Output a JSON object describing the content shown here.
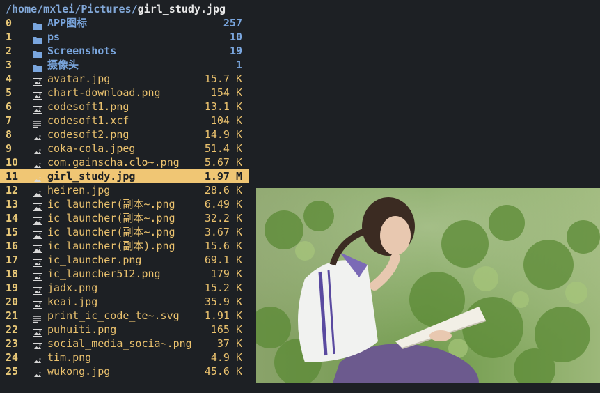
{
  "path": {
    "dir": "/home/mxlei/Pictures/",
    "file": "girl_study.jpg"
  },
  "entries": [
    {
      "num": "0",
      "name": "APP图标",
      "size": "257",
      "kind": "folder"
    },
    {
      "num": "1",
      "name": "ps",
      "size": "10",
      "kind": "folder"
    },
    {
      "num": "2",
      "name": "Screenshots",
      "size": "19",
      "kind": "folder"
    },
    {
      "num": "3",
      "name": "摄像头",
      "size": "1",
      "kind": "folder"
    },
    {
      "num": "4",
      "name": "avatar.jpg",
      "size": "15.7 K",
      "kind": "image"
    },
    {
      "num": "5",
      "name": "chart-download.png",
      "size": "154 K",
      "kind": "image"
    },
    {
      "num": "6",
      "name": "codesoft1.png",
      "size": "13.1 K",
      "kind": "image"
    },
    {
      "num": "7",
      "name": "codesoft1.xcf",
      "size": "104 K",
      "kind": "text"
    },
    {
      "num": "8",
      "name": "codesoft2.png",
      "size": "14.9 K",
      "kind": "image"
    },
    {
      "num": "9",
      "name": "coka-cola.jpeg",
      "size": "51.4 K",
      "kind": "image"
    },
    {
      "num": "10",
      "name": "com.gainscha.clo~.png",
      "size": "5.67 K",
      "kind": "image"
    },
    {
      "num": "11",
      "name": "girl_study.jpg",
      "size": "1.97 M",
      "kind": "image",
      "selected": true
    },
    {
      "num": "12",
      "name": "heiren.jpg",
      "size": "28.6 K",
      "kind": "image"
    },
    {
      "num": "13",
      "name": "ic_launcher(副本~.png",
      "size": "6.49 K",
      "kind": "image"
    },
    {
      "num": "14",
      "name": "ic_launcher(副本~.png",
      "size": "32.2 K",
      "kind": "image"
    },
    {
      "num": "15",
      "name": "ic_launcher(副本~.png",
      "size": "3.67 K",
      "kind": "image"
    },
    {
      "num": "16",
      "name": "ic_launcher(副本).png",
      "size": "15.6 K",
      "kind": "image"
    },
    {
      "num": "17",
      "name": "ic_launcher.png",
      "size": "69.1 K",
      "kind": "image"
    },
    {
      "num": "18",
      "name": "ic_launcher512.png",
      "size": "179 K",
      "kind": "image"
    },
    {
      "num": "19",
      "name": "jadx.png",
      "size": "15.2 K",
      "kind": "image"
    },
    {
      "num": "20",
      "name": "keai.jpg",
      "size": "35.9 K",
      "kind": "image"
    },
    {
      "num": "21",
      "name": "print_ic_code_te~.svg",
      "size": "1.91 K",
      "kind": "text"
    },
    {
      "num": "22",
      "name": "puhuiti.png",
      "size": "165 K",
      "kind": "image"
    },
    {
      "num": "23",
      "name": "social_media_socia~.png",
      "size": "37 K",
      "kind": "image"
    },
    {
      "num": "24",
      "name": "tim.png",
      "size": "4.9 K",
      "kind": "image"
    },
    {
      "num": "25",
      "name": "wukong.jpg",
      "size": "45.6 K",
      "kind": "image"
    }
  ],
  "colors": {
    "background": "#1d2024",
    "selection": "#f0c674",
    "file_text": "#ebc26e",
    "dir_text": "#7aa6de",
    "path_dir": "#82a8d8"
  },
  "preview": {
    "icon": "photo-preview"
  }
}
